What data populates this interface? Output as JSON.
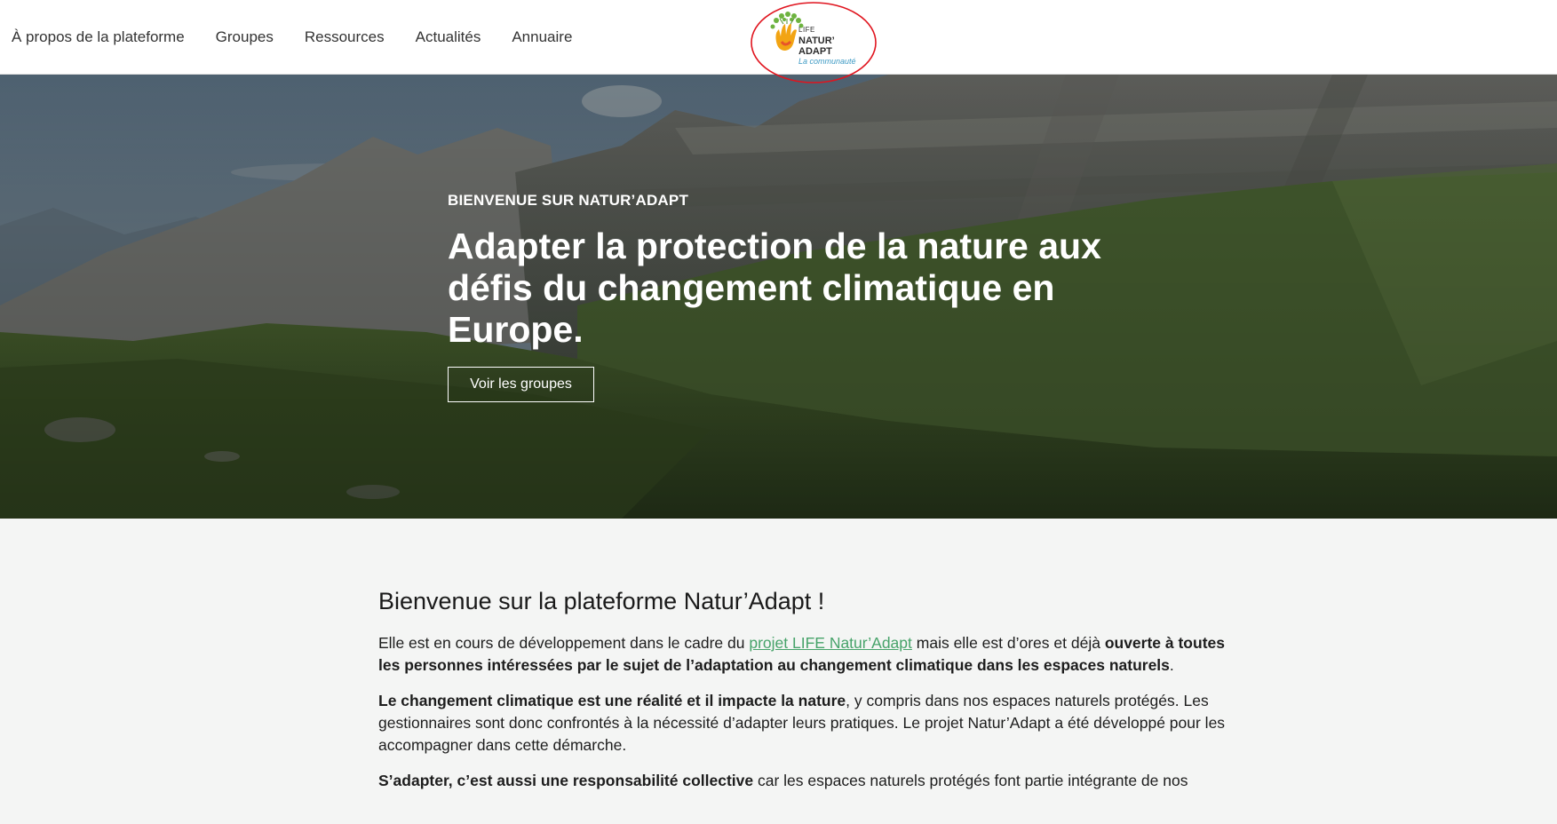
{
  "nav": {
    "items": [
      {
        "label": "À propos de la plateforme"
      },
      {
        "label": "Groupes"
      },
      {
        "label": "Ressources"
      },
      {
        "label": "Actualités"
      },
      {
        "label": "Annuaire"
      }
    ]
  },
  "logo": {
    "line1": "LIFE",
    "line2": "NATUR’",
    "line3": "ADAPT",
    "tagline": "La communauté",
    "annotation_color": "#e0141e"
  },
  "hero": {
    "eyebrow": "BIENVENUE SUR NATUR’ADAPT",
    "headline": "Adapter la protection de la nature aux défis du changement climatique en Europe.",
    "cta_label": "Voir les groupes"
  },
  "intro": {
    "title": "Bienvenue sur la plateforme Natur’Adapt !",
    "p1": {
      "before": "Elle est en cours de développement dans le cadre du ",
      "link": "projet LIFE Natur’Adapt",
      "middle": " mais elle est d’ores et déjà ",
      "bold": "ouverte à toutes les personnes intéressées par le sujet de l’adaptation au changement climatique dans les espaces naturels",
      "after": "."
    },
    "p2": {
      "bold": "Le changement climatique est une réalité et il impacte la nature",
      "rest": ", y compris dans nos espaces naturels protégés. Les gestionnaires sont donc confrontés à la nécessité d’adapter leurs pratiques. Le projet Natur’Adapt a été développé pour les accompagner dans cette démarche."
    },
    "p3": {
      "bold": "S’adapter, c’est aussi une responsabilité collective",
      "rest": " car les espaces naturels protégés font partie intégrante de nos"
    }
  },
  "colors": {
    "link": "#47a36a",
    "header_bg": "#ffffff",
    "page_bg": "#f4f5f4"
  }
}
